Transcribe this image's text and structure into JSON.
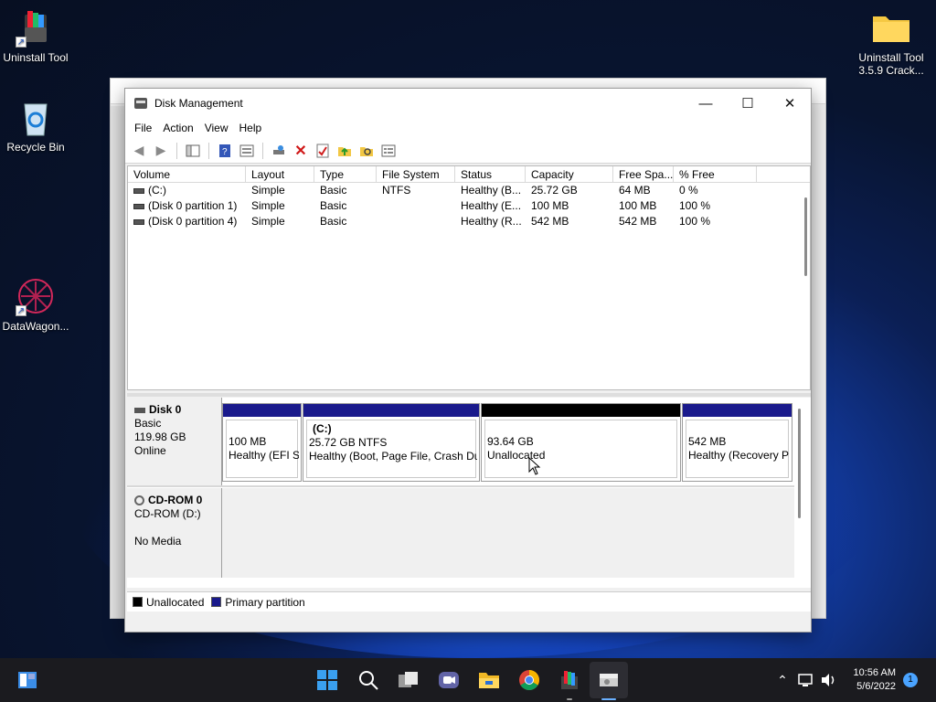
{
  "desktop": {
    "icons": [
      {
        "label": "Uninstall Tool"
      },
      {
        "label": "Recycle Bin"
      },
      {
        "label": "DataWagon..."
      },
      {
        "label_line1": "Uninstall Tool",
        "label_line2": "3.5.9  Crack..."
      }
    ]
  },
  "window": {
    "title": "Disk Management",
    "minimize": "—",
    "maximize": "☐",
    "close": "✕",
    "menu": [
      "File",
      "Action",
      "View",
      "Help"
    ]
  },
  "volume_table": {
    "columns": [
      "Volume",
      "Layout",
      "Type",
      "File System",
      "Status",
      "Capacity",
      "Free Spa...",
      "% Free"
    ],
    "rows": [
      [
        "(C:)",
        "Simple",
        "Basic",
        "NTFS",
        "Healthy (B...",
        "25.72 GB",
        "64 MB",
        "0 %"
      ],
      [
        "(Disk 0 partition 1)",
        "Simple",
        "Basic",
        "",
        "Healthy (E...",
        "100 MB",
        "100 MB",
        "100 %"
      ],
      [
        "(Disk 0 partition 4)",
        "Simple",
        "Basic",
        "",
        "Healthy (R...",
        "542 MB",
        "542 MB",
        "100 %"
      ]
    ]
  },
  "disks": {
    "disk0": {
      "name": "Disk 0",
      "type": "Basic",
      "size": "119.98 GB",
      "state": "Online",
      "partitions": [
        {
          "line1": "",
          "line2": "100 MB",
          "line3": "Healthy (EFI S"
        },
        {
          "line1": "(C:)",
          "line2": "25.72 GB NTFS",
          "line3": "Healthy (Boot, Page File, Crash Du"
        },
        {
          "line1": "",
          "line2": "93.64 GB",
          "line3": "Unallocated"
        },
        {
          "line1": "",
          "line2": "542 MB",
          "line3": "Healthy (Recovery P"
        }
      ]
    },
    "cdrom0": {
      "name": "CD-ROM 0",
      "type": "CD-ROM (D:)",
      "state": "No Media"
    }
  },
  "legend": {
    "unallocated": "Unallocated",
    "primary": "Primary partition"
  },
  "colors": {
    "primary_partition": "#1a1a8c",
    "unallocated": "#000000"
  },
  "taskbar": {
    "time": "10:56 AM",
    "date": "5/6/2022",
    "notification_count": "1"
  }
}
